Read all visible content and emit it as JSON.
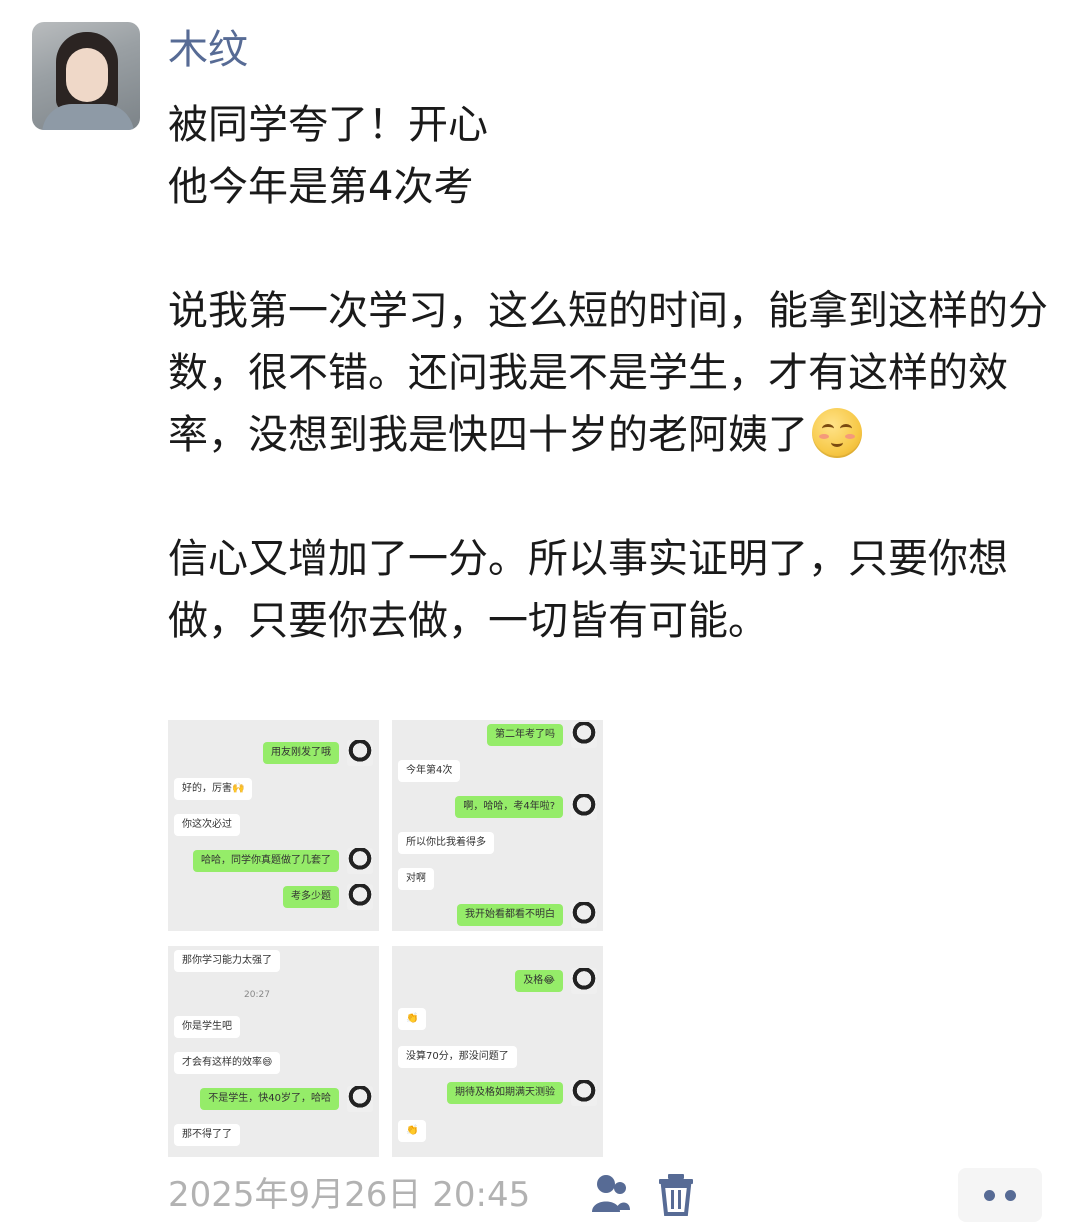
{
  "user": {
    "name": "木纹"
  },
  "post": {
    "text_before_emoji": "被同学夸了！开心\n他今年是第4次考\n\n说我第一次学习，这么短的时间，能拿到这样的分数，很不错。还问我是不是学生，才有这样的效率，没想到我是快四十岁的老阿姨了",
    "emoji": "shy-smile-emoji",
    "text_after_emoji": "\n\n信心又增加了一分。所以事实证明了，只要你想做，只要你去做，一切皆有可能。"
  },
  "screenshots": [
    {
      "messages": [
        {
          "who": "me",
          "text": "用友刚发了哦"
        },
        {
          "who": "other",
          "text": "好的，厉害🙌"
        },
        {
          "who": "other",
          "text": "你这次必过"
        },
        {
          "who": "me",
          "text": "哈哈，同学你真题做了几套了"
        },
        {
          "who": "me",
          "text": "考多少题"
        }
      ]
    },
    {
      "messages": [
        {
          "who": "me",
          "text": "第二年考了吗"
        },
        {
          "who": "other",
          "text": "今年第4次"
        },
        {
          "who": "me",
          "text": "啊，哈哈，考4年啦?"
        },
        {
          "who": "other",
          "text": "所以你比我着得多"
        },
        {
          "who": "other",
          "text": "对啊"
        },
        {
          "who": "me",
          "text": "我开始看都看不明白"
        }
      ]
    },
    {
      "time": "20:27",
      "messages": [
        {
          "who": "other",
          "text": "那你学习能力太强了"
        },
        {
          "who": "other",
          "text": "你是学生吧"
        },
        {
          "who": "other",
          "text": "才会有这样的效率😄"
        },
        {
          "who": "me",
          "text": "不是学生，快40岁了，哈哈"
        },
        {
          "who": "other",
          "text": "那不得了了"
        }
      ]
    },
    {
      "messages": [
        {
          "who": "me",
          "text": "及格😂"
        },
        {
          "who": "other",
          "text": "👏"
        },
        {
          "who": "other",
          "text": "没算70分，那没问题了"
        },
        {
          "who": "me",
          "text": "期待及格如期满天测验"
        },
        {
          "who": "other",
          "text": "👏"
        }
      ]
    }
  ],
  "footer": {
    "timestamp": "2025年9月26日 20:45"
  },
  "colors": {
    "username": "#576b95",
    "timestamp": "#b2b2b2",
    "chat_green": "#95ec69"
  }
}
